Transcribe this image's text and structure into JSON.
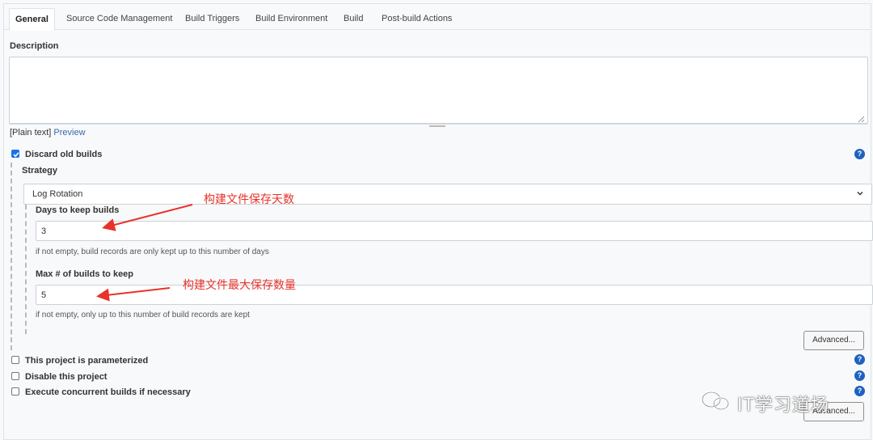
{
  "tabs": [
    {
      "label": "General",
      "active": true
    },
    {
      "label": "Source Code Management"
    },
    {
      "label": "Build Triggers"
    },
    {
      "label": "Build Environment"
    },
    {
      "label": "Build"
    },
    {
      "label": "Post-build Actions"
    }
  ],
  "description": {
    "label": "Description",
    "value": "",
    "format_prefix": "[Plain text]",
    "preview_link": "Preview"
  },
  "discard_old_builds": {
    "label": "Discard old builds",
    "checked": true,
    "strategy_label": "Strategy",
    "strategy_value": "Log Rotation",
    "days_label": "Days to keep builds",
    "days_value": "3",
    "days_hint": "if not empty, build records are only kept up to this number of days",
    "max_label": "Max # of builds to keep",
    "max_value": "5",
    "max_hint": "if not empty, only up to this number of build records are kept",
    "advanced_label": "Advanced..."
  },
  "options": [
    {
      "label": "This project is parameterized",
      "checked": false
    },
    {
      "label": "Disable this project",
      "checked": false
    },
    {
      "label": "Execute concurrent builds if necessary",
      "checked": false
    }
  ],
  "bottom_advanced_label": "Advanced...",
  "help_icon": "?",
  "annotations": {
    "days": "构建文件保存天数",
    "max": "构建文件最大保存数量"
  },
  "watermark": "IT学习道场",
  "colors": {
    "accent": "#1a73e8",
    "annotation": "#e8322a",
    "help": "#1c63bf"
  }
}
